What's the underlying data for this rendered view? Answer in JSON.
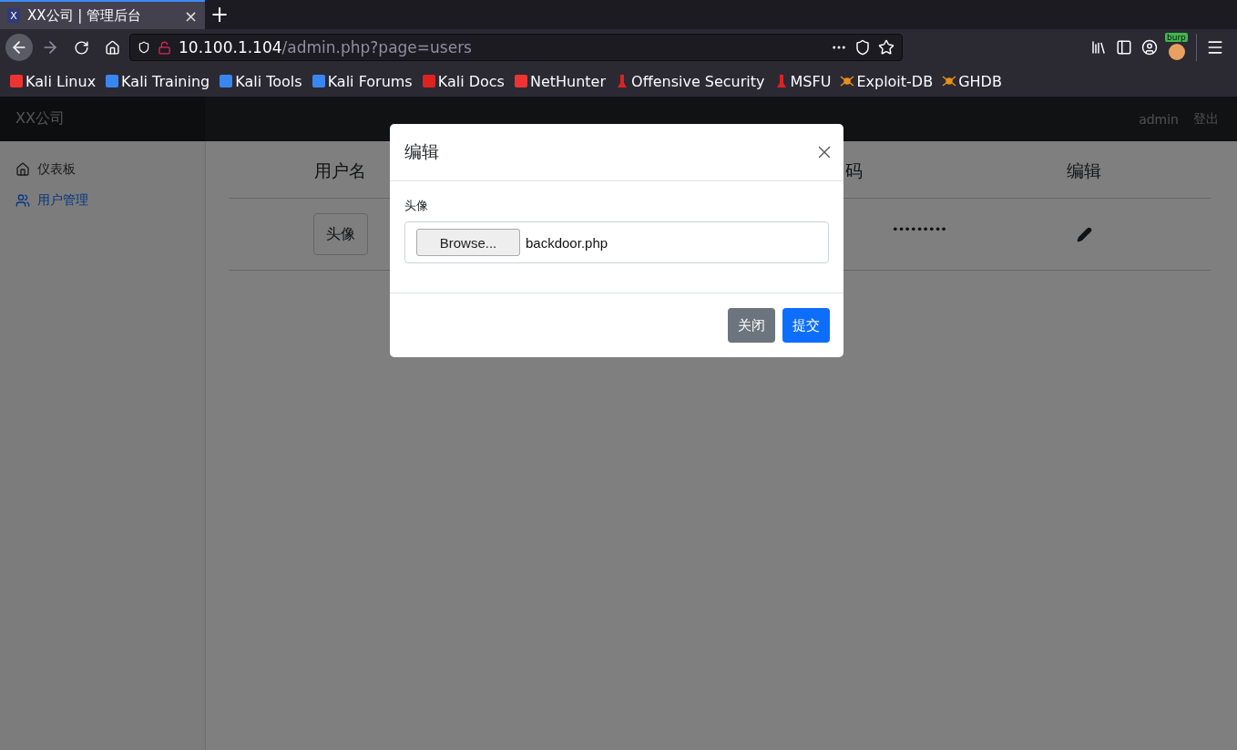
{
  "browser": {
    "tab": {
      "favicon": "X",
      "title": "XX公司 | 管理后台",
      "close": "×",
      "selected": true
    },
    "new_tab": "+",
    "url": {
      "host": "10.100.1.104",
      "path": "/admin.php?page=users"
    },
    "extension_badge": "burp",
    "bookmarks": [
      {
        "label": "Kali Linux",
        "kind": "kali"
      },
      {
        "label": "Kali Training",
        "kind": "tool"
      },
      {
        "label": "Kali Tools",
        "kind": "tool"
      },
      {
        "label": "Kali Forums",
        "kind": "tool"
      },
      {
        "label": "Kali Docs",
        "kind": "docs"
      },
      {
        "label": "NetHunter",
        "kind": "kali"
      },
      {
        "label": "Offensive Security",
        "kind": "offsec"
      },
      {
        "label": "MSFU",
        "kind": "offsec"
      },
      {
        "label": "Exploit-DB",
        "kind": "spider"
      },
      {
        "label": "GHDB",
        "kind": "spider"
      }
    ]
  },
  "navbar": {
    "brand": "XX公司",
    "user": "admin",
    "logout": "登出"
  },
  "sidebar": {
    "items": [
      {
        "label": "仪表板",
        "kind": "dashboard",
        "selected": false
      },
      {
        "label": "用户管理",
        "kind": "users",
        "selected": true
      }
    ]
  },
  "table": {
    "columns": [
      "用户名",
      "码",
      "编辑"
    ],
    "rows": [
      {
        "avatar": "头像",
        "password": "•••••••••"
      }
    ]
  },
  "modal": {
    "title": "编辑",
    "field_label": "头像",
    "browse": "Browse...",
    "file_name": "backdoor.php",
    "buttons": [
      {
        "label": "关闭",
        "kind": "secondary"
      },
      {
        "label": "提交",
        "kind": "primary"
      }
    ]
  }
}
